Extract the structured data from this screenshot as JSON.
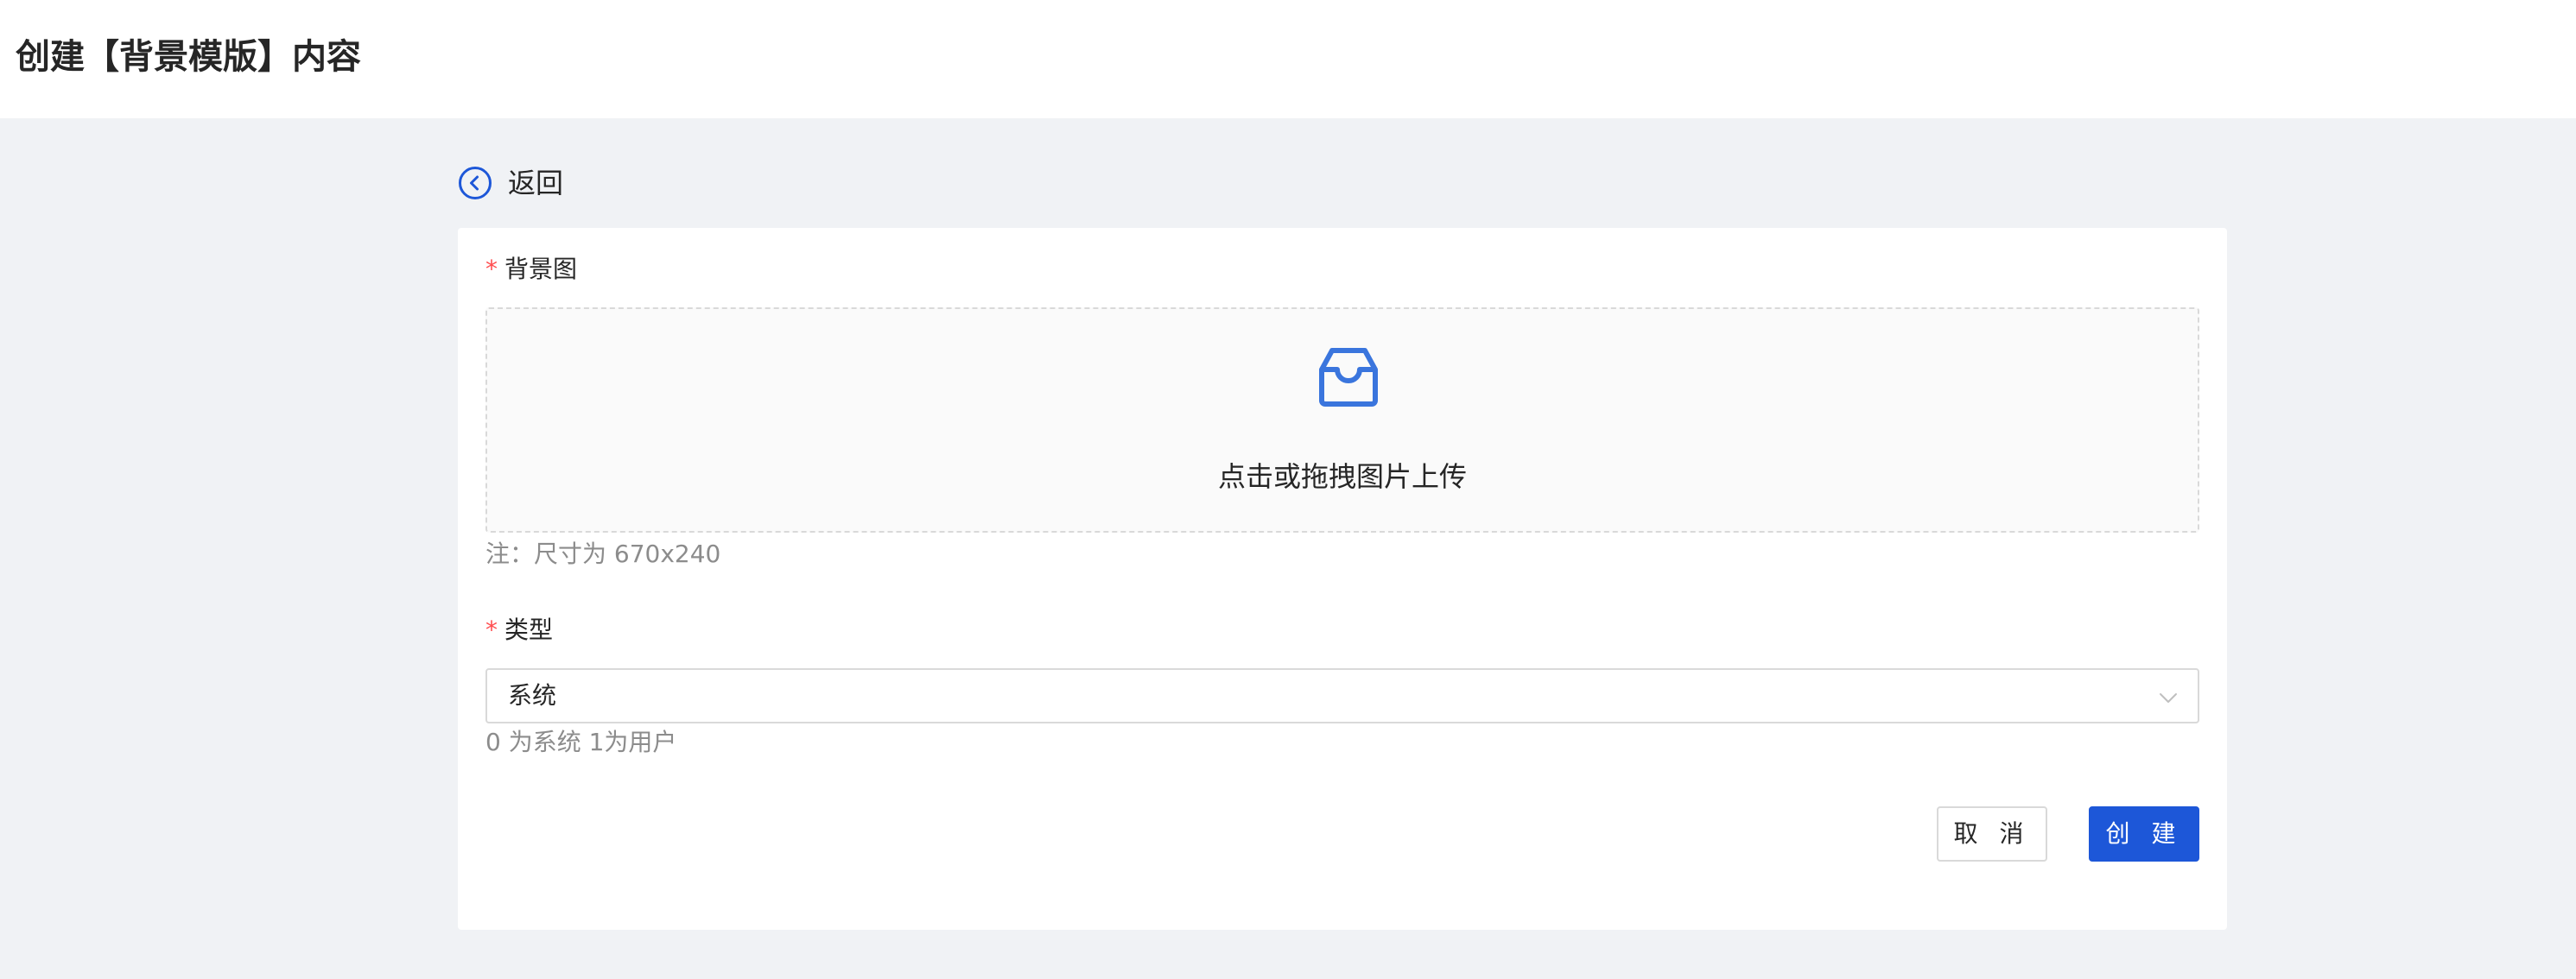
{
  "header": {
    "title": "创建【背景模版】内容"
  },
  "nav": {
    "back_label": "返回"
  },
  "form": {
    "background": {
      "required_mark": "*",
      "label": "背景图",
      "upload_hint": "点击或拖拽图片上传",
      "note": "注：尺寸为 670x240"
    },
    "type": {
      "required_mark": "*",
      "label": "类型",
      "selected_value": "系统",
      "help": "0 为系统 1为用户"
    },
    "actions": {
      "cancel_label": "取 消",
      "create_label": "创 建"
    }
  },
  "colors": {
    "accent": "#1d57d8",
    "required": "#ff4d4f",
    "page_background": "#f0f2f5",
    "muted_text": "#8c8c8c"
  },
  "icons": {
    "back": "circle-chevron-left-icon",
    "upload": "inbox-icon",
    "select": "chevron-down-icon"
  }
}
